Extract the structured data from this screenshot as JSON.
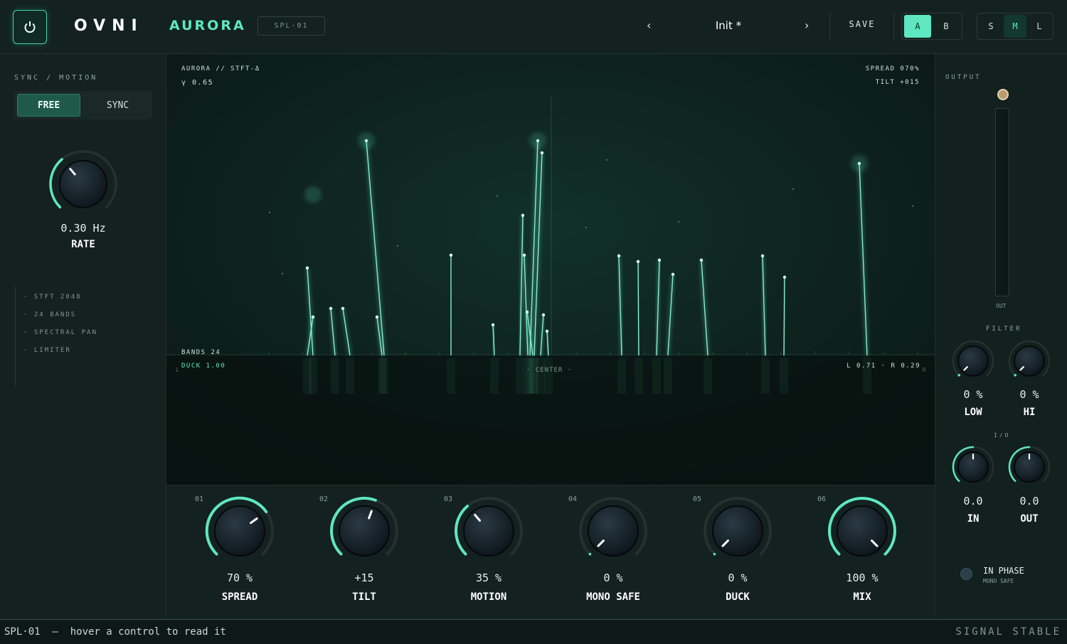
{
  "header": {
    "brand": "OVNI",
    "product": "AURORA",
    "tag": "SPL·01",
    "prev": "‹",
    "next": "›",
    "preset": "Init *",
    "save": "SAVE",
    "ab": [
      "A",
      "B"
    ],
    "ab_active": "A",
    "size": [
      "S",
      "M",
      "L"
    ],
    "size_active": "M",
    "icons": {
      "power": "power-icon"
    }
  },
  "left": {
    "section": "SYNC / MOTION",
    "modes": [
      "FREE",
      "SYNC"
    ],
    "mode_active": "FREE",
    "rate": {
      "value": "0.30 Hz",
      "label": "RATE",
      "level": 0.35
    },
    "info": [
      "· STFT 2048",
      "· 24 BANDS",
      "· SPECTRAL PAN",
      "· LIMITER"
    ]
  },
  "viz": {
    "top_left_1": "AURORA // STFT-Δ",
    "top_left_2": "γ 0.65",
    "top_right_1": "SPREAD 070%",
    "top_right_2": "TILT +015",
    "bands": "BANDS 24",
    "duck": "DUCK 1.00",
    "center": "· CENTER ·",
    "balance": "L 0.71 · R 0.29",
    "edge_l": "L",
    "edge_r": "R"
  },
  "knobs": [
    {
      "num": "01",
      "value": "70 %",
      "label": "SPREAD",
      "level": 0.7
    },
    {
      "num": "02",
      "value": "+15",
      "label": "TILT",
      "level": 0.575
    },
    {
      "num": "03",
      "value": "35 %",
      "label": "MOTION",
      "level": 0.35
    },
    {
      "num": "04",
      "value": "0 %",
      "label": "MONO SAFE",
      "level": 0.0
    },
    {
      "num": "05",
      "value": "0 %",
      "label": "DUCK",
      "level": 0.0
    },
    {
      "num": "06",
      "value": "100 %",
      "label": "MIX",
      "level": 1.0
    }
  ],
  "right": {
    "output": "OUTPUT",
    "out": "OUT",
    "filter": "FILTER",
    "low": {
      "value": "0 %",
      "label": "LOW",
      "level": 0
    },
    "hi": {
      "value": "0 %",
      "label": "HI",
      "level": 0
    },
    "io": "I/O",
    "in_knob": {
      "value": "0.0",
      "label": "IN",
      "level": 0.5
    },
    "out_knob": {
      "value": "0.0",
      "label": "OUT",
      "level": 0.5
    },
    "phase": "IN PHASE",
    "phase_sub": "MONO SAFE"
  },
  "status": {
    "left": "SPL·01  —  hover a control to read it",
    "right": "SIGNAL STABLE"
  },
  "colors": {
    "accent": "#5ee7c0",
    "bg": "#101c1a"
  }
}
